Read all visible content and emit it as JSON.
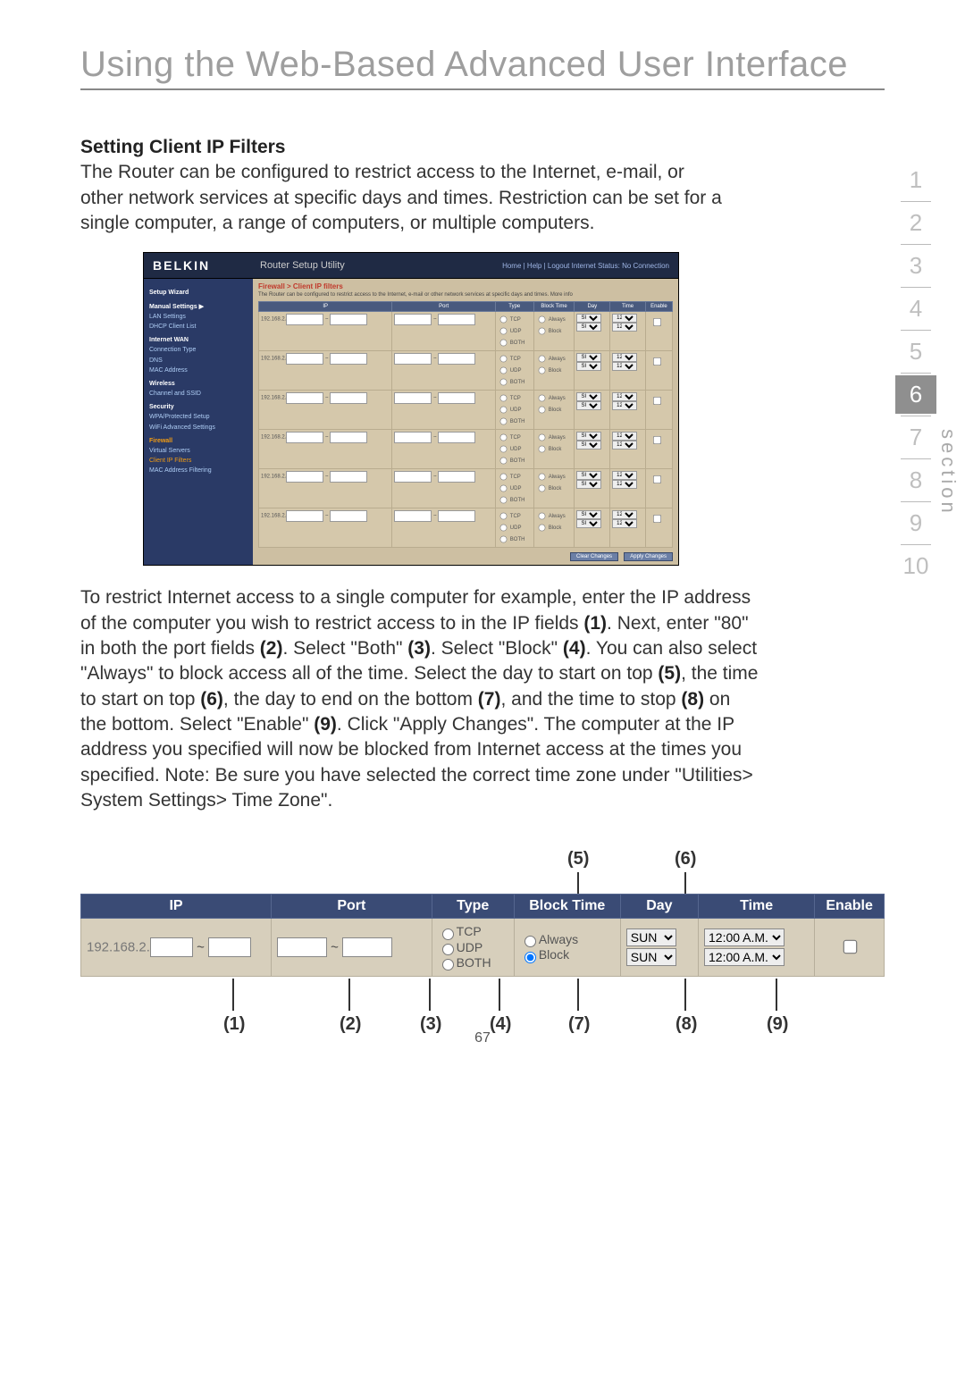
{
  "title": "Using the Web-Based Advanced User Interface",
  "section_label": "section",
  "nav_items": [
    "1",
    "2",
    "3",
    "4",
    "5",
    "6",
    "7",
    "8",
    "9",
    "10"
  ],
  "nav_active_index": 5,
  "page_number": "67",
  "heading": "Setting Client IP Filters",
  "intro": "The Router can be configured to restrict access to the Internet, e-mail, or other network services at specific days and times. Restriction can be set for a single computer, a range of computers, or multiple computers.",
  "body2_parts": [
    "To restrict Internet access to a single computer for example, enter the IP address of the computer you wish to restrict access to in the IP fields ",
    "(1)",
    ". Next, enter \"80\" in both the port fields ",
    "(2)",
    ". Select \"Both\" ",
    "(3)",
    ". Select \"Block\" ",
    "(4)",
    ". You can also select \"Always\" to block access all of the time. Select the day to start on top ",
    "(5)",
    ", the time to start on top ",
    "(6)",
    ", the day to end on the bottom ",
    "(7)",
    ", and the time to stop ",
    "(8)",
    " on the bottom. Select \"Enable\" ",
    "(9)",
    ". Click \"Apply Changes\". The computer at the IP address you specified will now be blocked from Internet access at the times you specified. Note: Be sure you have selected the correct time zone under \"Utilities> System Settings> Time Zone\"."
  ],
  "shot": {
    "brand": "BELKIN",
    "utility": "Router Setup Utility",
    "top_links": "Home | Help | Logout    Internet Status: No Connection",
    "sidebar": {
      "setup_wizard": "Setup Wizard",
      "manual": "Manual Settings ▶",
      "items": [
        "LAN Settings",
        "LAN Settings",
        "DHCP Client List",
        "Internet WAN",
        "Connection Type",
        "DNS",
        "MAC Address",
        "Wireless",
        "Channel and SSID",
        "Security",
        "WPA/Protected Setup",
        "WiFi Advanced Settings",
        "Firewall",
        "Virtual Servers",
        "Client IP Filters",
        "MAC Address Filtering"
      ]
    },
    "crumb": "Firewall > Client IP filters",
    "desc": "The Router can be configured to restrict access to the Internet, e-mail or other network services at specific days and times. More info",
    "headers": [
      "IP",
      "Port",
      "Type",
      "Block Time",
      "Day",
      "Time",
      "Enable"
    ],
    "row_prefix": "192.168.2.",
    "type_opts": [
      "TCP",
      "UDP",
      "BOTH"
    ],
    "block_opts": [
      "Always",
      "Block"
    ],
    "day": "SUN",
    "time": "12:00 A.M.",
    "buttons": {
      "clear": "Clear Changes",
      "apply": "Apply Changes"
    }
  },
  "enlarged": {
    "headers": [
      "IP",
      "Port",
      "Type",
      "Block Time",
      "Day",
      "Time",
      "Enable"
    ],
    "ip_prefix": "192.168.2.",
    "type_opts": [
      "TCP",
      "UDP",
      "BOTH"
    ],
    "block_opts": [
      "Always",
      "Block"
    ],
    "day": "SUN",
    "time": "12:00 A.M.",
    "callouts_top": {
      "5": "(5)",
      "6": "(6)"
    },
    "callouts_bot": {
      "1": "(1)",
      "2": "(2)",
      "3": "(3)",
      "4": "(4)",
      "7": "(7)",
      "8": "(8)",
      "9": "(9)"
    }
  }
}
